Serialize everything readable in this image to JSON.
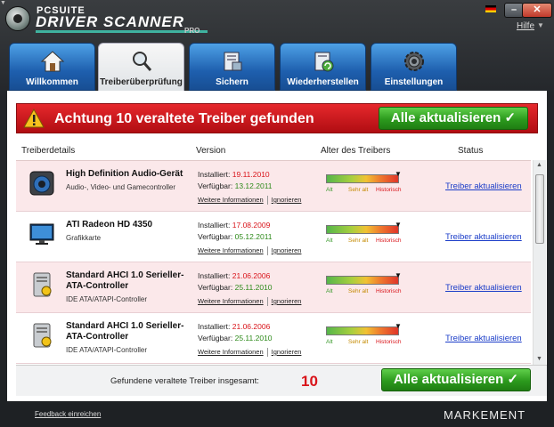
{
  "window": {
    "logo_small": "PCSUITE",
    "logo_main": "DRIVER SCANNER",
    "logo_pro": "PRO",
    "help_label": "Hilfe",
    "minimize_label": "–",
    "close_label": "✕"
  },
  "tabs": [
    {
      "label": "Willkommen",
      "icon": "home-icon",
      "active": false
    },
    {
      "label": "Treiberüberprüfung",
      "icon": "magnifier-icon",
      "active": true
    },
    {
      "label": "Sichern",
      "icon": "backup-icon",
      "active": false
    },
    {
      "label": "Wiederherstellen",
      "icon": "restore-icon",
      "active": false
    },
    {
      "label": "Einstellungen",
      "icon": "settings-icon",
      "active": false
    }
  ],
  "alert": {
    "text": "Achtung 10 veraltete Treiber gefunden",
    "button_label": "Alle aktualisieren ✓"
  },
  "table": {
    "headers": [
      "Treiberdetails",
      "Version",
      "Alter des Treibers",
      "Status"
    ],
    "age_labels": [
      "Alt",
      "Sehr alt",
      "Historisch"
    ],
    "rows": [
      {
        "name": "High Definition Audio-Gerät",
        "category": "Audio-, Video- und Gamecontroller",
        "installed_label": "Installiert:",
        "installed": "19.11.2010",
        "available_label": "Verfügbar:",
        "available": "13.12.2011",
        "more_info": "Weitere Informationen",
        "ignore": "Ignorieren",
        "status": "Treiber aktualisieren",
        "icon": "speaker-icon"
      },
      {
        "name": "ATI Radeon HD 4350",
        "category": "Grafikkarte",
        "installed_label": "Installiert:",
        "installed": "17.08.2009",
        "available_label": "Verfügbar:",
        "available": "05.12.2011",
        "more_info": "Weitere Informationen",
        "ignore": "Ignorieren",
        "status": "Treiber aktualisieren",
        "icon": "monitor-icon"
      },
      {
        "name": "Standard AHCI 1.0 Serieller-ATA-Controller",
        "category": "IDE ATA/ATAPI-Controller",
        "installed_label": "Installiert:",
        "installed": "21.06.2006",
        "available_label": "Verfügbar:",
        "available": "25.11.2010",
        "more_info": "Weitere Informationen",
        "ignore": "Ignorieren",
        "status": "Treiber aktualisieren",
        "icon": "drive-icon"
      },
      {
        "name": "Standard AHCI 1.0 Serieller-ATA-Controller",
        "category": "IDE ATA/ATAPI-Controller",
        "installed_label": "Installiert:",
        "installed": "21.06.2006",
        "available_label": "Verfügbar:",
        "available": "25.11.2010",
        "more_info": "Weitere Informationen",
        "ignore": "Ignorieren",
        "status": "Treiber aktualisieren",
        "icon": "drive-icon"
      }
    ]
  },
  "summary": {
    "label": "Gefundene veraltete Treiber insgesamt:",
    "count": "10",
    "button_label": "Alle aktualisieren ✓"
  },
  "footer": {
    "feedback": "Feedback einreichen",
    "brand": "MARKEMENT"
  }
}
